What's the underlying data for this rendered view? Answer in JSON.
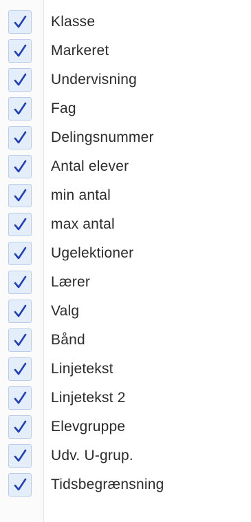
{
  "colors": {
    "check": "#1f3fbf",
    "checkbox_bg": "#e4eefb",
    "checkbox_border": "#b8cde9",
    "text": "#2b2b2b"
  },
  "columns": {
    "items": [
      {
        "label": "Klasse",
        "checked": true
      },
      {
        "label": "Markeret",
        "checked": true
      },
      {
        "label": "Undervisning",
        "checked": true
      },
      {
        "label": "Fag",
        "checked": true
      },
      {
        "label": "Delingsnummer",
        "checked": true
      },
      {
        "label": "Antal elever",
        "checked": true
      },
      {
        "label": "min antal",
        "checked": true
      },
      {
        "label": "max antal",
        "checked": true
      },
      {
        "label": "Ugelektioner",
        "checked": true
      },
      {
        "label": "Lærer",
        "checked": true
      },
      {
        "label": "Valg",
        "checked": true
      },
      {
        "label": "Bånd",
        "checked": true
      },
      {
        "label": "Linjetekst",
        "checked": true
      },
      {
        "label": "Linjetekst 2",
        "checked": true
      },
      {
        "label": "Elevgruppe",
        "checked": true
      },
      {
        "label": "Udv. U-grup.",
        "checked": true
      },
      {
        "label": "Tidsbegrænsning",
        "checked": true
      }
    ]
  }
}
